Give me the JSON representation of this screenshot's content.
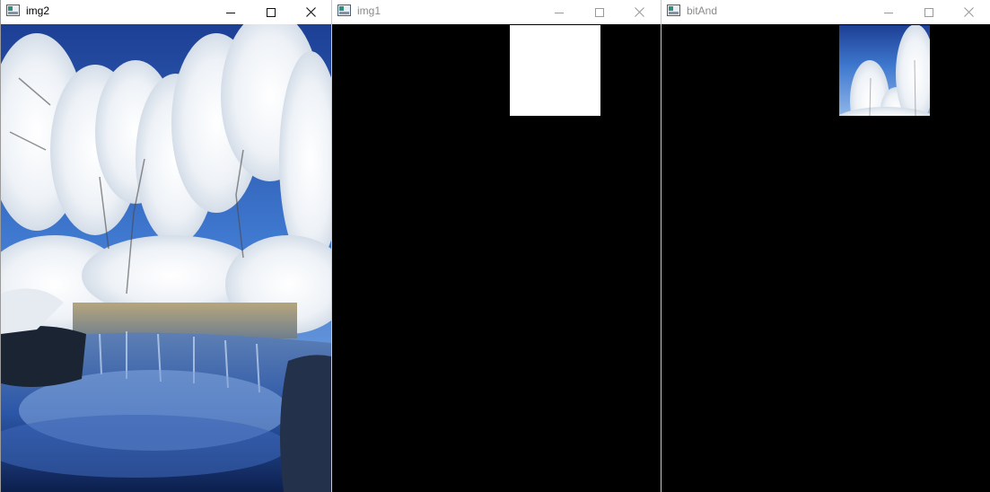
{
  "windows": [
    {
      "id": "img2",
      "title": "img2",
      "state": "active",
      "content": "snowy-forest-waterfall-photo",
      "controls": [
        "minimize-icon",
        "maximize-icon",
        "close-icon"
      ]
    },
    {
      "id": "img1",
      "title": "img1",
      "state": "inactive",
      "content": "white-square-mask-on-black",
      "controls": [
        "minimize-icon",
        "maximize-icon",
        "close-icon"
      ]
    },
    {
      "id": "bitAnd",
      "title": "bitAnd",
      "state": "inactive",
      "content": "masked-photo-region-on-black",
      "controls": [
        "minimize-icon",
        "maximize-icon",
        "close-icon"
      ]
    }
  ],
  "colors": {
    "title_active": "#000000",
    "title_inactive": "#8a8a8a",
    "titlebar_bg": "#ffffff",
    "canvas_bg": "#000000",
    "mask_fill": "#ffffff"
  }
}
